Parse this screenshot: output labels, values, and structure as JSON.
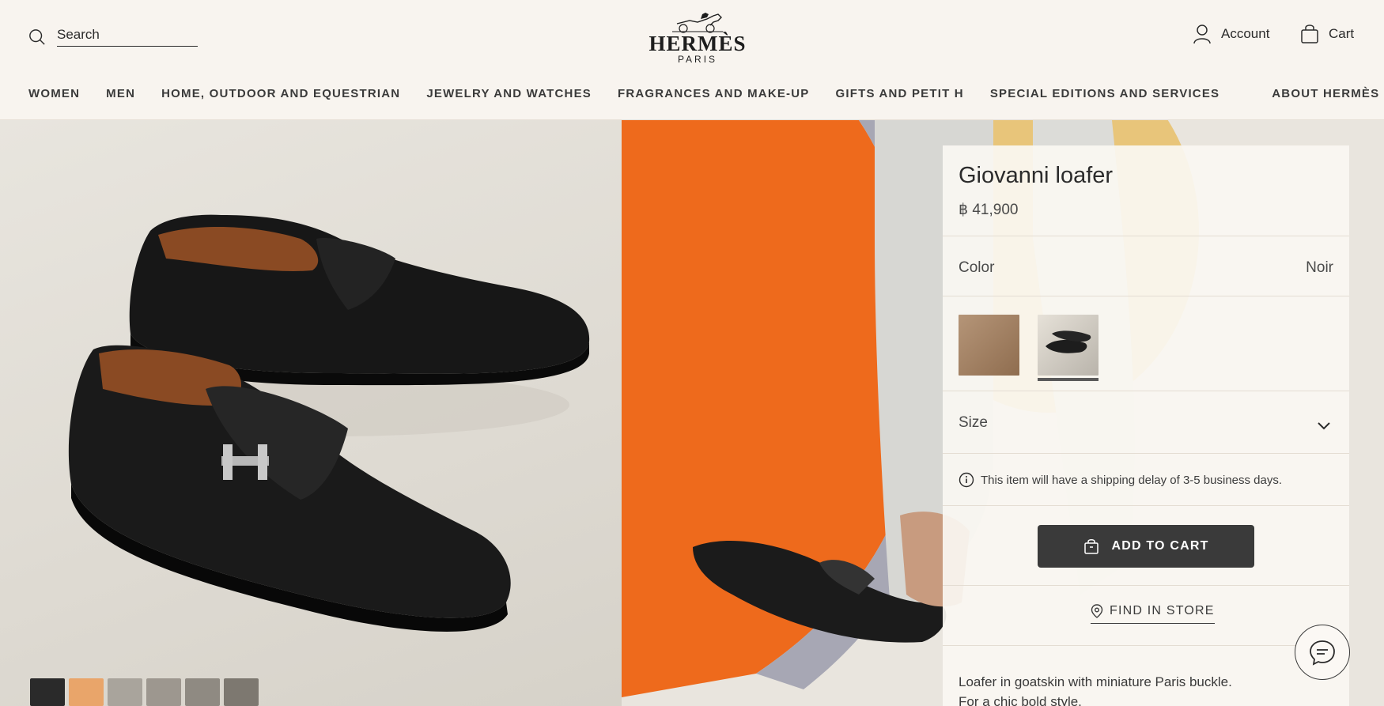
{
  "header": {
    "search_placeholder": "Search",
    "logo_name": "HERMÈS",
    "logo_city": "PARIS",
    "account_label": "Account",
    "cart_label": "Cart"
  },
  "nav": {
    "items": [
      "WOMEN",
      "MEN",
      "HOME, OUTDOOR AND EQUESTRIAN",
      "JEWELRY AND WATCHES",
      "FRAGRANCES AND MAKE-UP",
      "GIFTS AND PETIT H",
      "SPECIAL EDITIONS AND SERVICES"
    ],
    "about": "ABOUT HERMÈS"
  },
  "product": {
    "title": "Giovanni loafer",
    "price": "฿ 41,900",
    "color_label": "Color",
    "color_value": "Noir",
    "size_label": "Size",
    "shipping_notice": "This item will have a shipping delay of 3-5 business days.",
    "add_to_cart": "ADD TO CART",
    "find_in_store": "FIND IN STORE",
    "description_line1": "Loafer in goatskin with miniature Paris buckle.",
    "description_line2": "For a chic bold style."
  },
  "colors": {
    "accent_dark": "#3a3a3a",
    "background": "#f8f4ef",
    "orange": "#ee6a1c"
  }
}
